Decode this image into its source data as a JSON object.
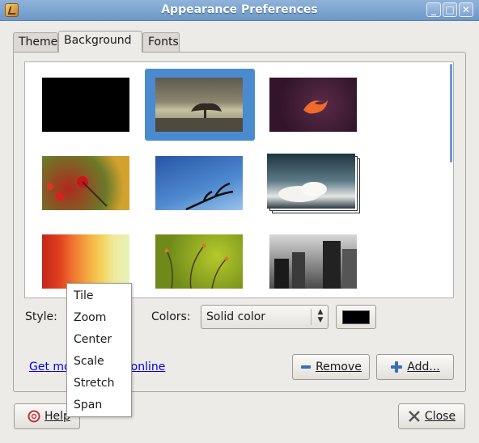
{
  "window": {
    "title": "Appearance Preferences",
    "controls": {
      "minimize": "_",
      "maximize": "□",
      "close": "✕"
    }
  },
  "tabs": [
    {
      "label": "Theme",
      "active": false
    },
    {
      "label": "Background",
      "active": true
    },
    {
      "label": "Fonts",
      "active": false
    }
  ],
  "gallery": {
    "selected_index": 1,
    "wallpapers": [
      {
        "name": "black-solid",
        "icon": "solid-black-wallpaper"
      },
      {
        "name": "sepia-landscape",
        "icon": "sepia-landscape-wallpaper"
      },
      {
        "name": "purple-bird",
        "icon": "purple-bird-wallpaper"
      },
      {
        "name": "red-berries",
        "icon": "red-berries-wallpaper"
      },
      {
        "name": "blue-sky-branch",
        "icon": "blue-sky-branch-wallpaper"
      },
      {
        "name": "clouds-stack",
        "icon": "clouds-stack-wallpaper"
      },
      {
        "name": "colored-fabric",
        "icon": "colored-fabric-wallpaper"
      },
      {
        "name": "green-stems",
        "icon": "green-stems-wallpaper"
      },
      {
        "name": "city-buildings",
        "icon": "city-buildings-wallpaper"
      }
    ]
  },
  "style": {
    "label": "Style:",
    "menu_options": [
      "Tile",
      "Zoom",
      "Center",
      "Scale",
      "Stretch",
      "Span"
    ]
  },
  "colors": {
    "label": "Colors:",
    "selected": "Solid color",
    "swatch": "#000000"
  },
  "link": {
    "visible_left": "Get mo",
    "visible_right": "nds online"
  },
  "buttons": {
    "remove": "Remove",
    "add": "Add...",
    "help": "Help",
    "close": "Close"
  },
  "palette": {
    "accent": "#4a8bd0",
    "link": "#0000ee",
    "window_bg": "#edebe8"
  }
}
